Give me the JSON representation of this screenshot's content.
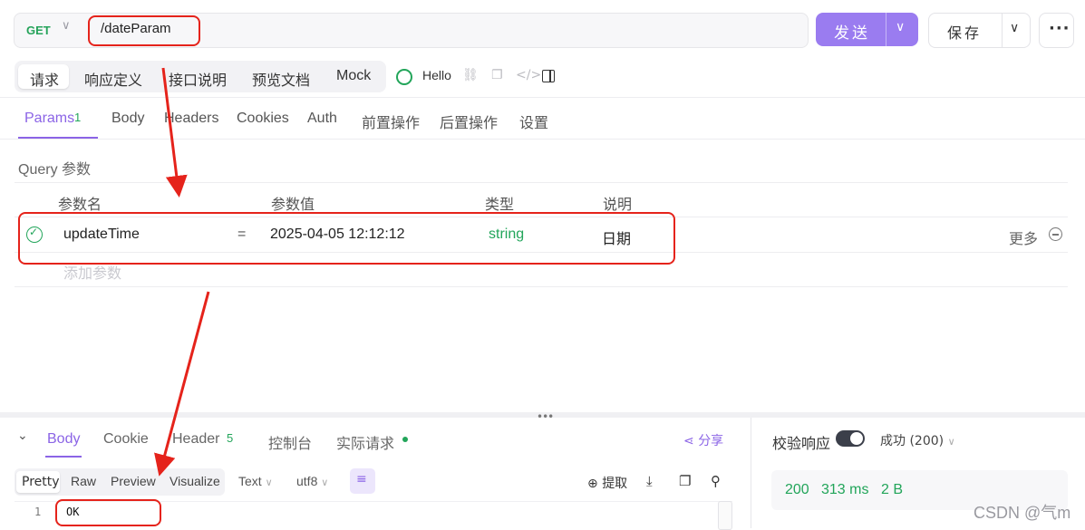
{
  "request": {
    "method": "GET",
    "path": "/dateParam",
    "send_label": "发送",
    "save_label": "保存"
  },
  "main_tabs": [
    "请求",
    "响应定义",
    "接口说明",
    "预览文档",
    "Mock"
  ],
  "env_name": "Hello",
  "param_tabs": {
    "params": "Params",
    "params_count": "1",
    "items": [
      "Body",
      "Headers",
      "Cookies",
      "Auth",
      "前置操作",
      "后置操作",
      "设置"
    ]
  },
  "query": {
    "section_label": "Query 参数",
    "headers": [
      "参数名",
      "参数值",
      "类型",
      "说明"
    ],
    "rows": [
      {
        "name": "updateTime",
        "eq": "=",
        "value": "2025-04-05 12:12:12",
        "type": "string",
        "desc": "日期",
        "more": "更多"
      }
    ],
    "add_placeholder": "添加参数"
  },
  "response": {
    "tabs": {
      "body": "Body",
      "cookie": "Cookie",
      "header": "Header",
      "header_count": "5",
      "console": "控制台",
      "actual": "实际请求"
    },
    "share": "分享",
    "formats": [
      "Pretty",
      "Raw",
      "Preview",
      "Visualize"
    ],
    "text_select": "Text",
    "encoding_select": "utf8",
    "extract": "提取",
    "code_lines": [
      {
        "num": "1",
        "text": "OK"
      }
    ]
  },
  "validation": {
    "label": "校验响应",
    "enabled": true,
    "status_select": "成功 (200)",
    "status_code": "200",
    "time": "313 ms",
    "size": "2 B"
  },
  "watermark": "CSDN @气m",
  "colors": {
    "accent": "#8b64e6",
    "send": "#9a7cf0",
    "success": "#22a55a",
    "annotation": "#e5231b"
  }
}
